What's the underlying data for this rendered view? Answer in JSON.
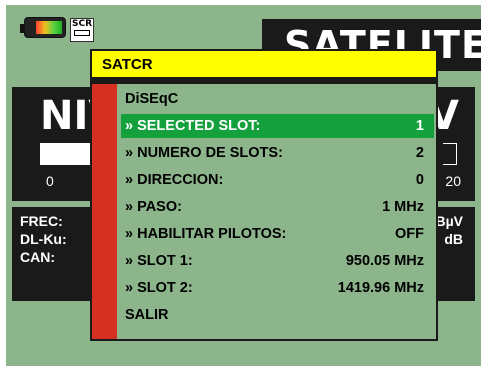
{
  "top_bar": {
    "battery_icon": "battery-icon",
    "scr_label": "SCR",
    "mode_title": "SATELITE"
  },
  "level_panel": {
    "title": "NIV",
    "unit_fragment": "V",
    "scale_min": "0",
    "scale_max": "20"
  },
  "measurements": {
    "labels": [
      "FREC:",
      "DL-Ku:",
      "CAN:"
    ],
    "units": [
      "dBµV",
      "dB"
    ]
  },
  "menu": {
    "title": "SATCR",
    "items": [
      {
        "label": "DiSEqC",
        "value": ""
      },
      {
        "label": "» SELECTED SLOT:",
        "value": "1"
      },
      {
        "label": "» NUMERO DE SLOTS:",
        "value": "2"
      },
      {
        "label": "» DIRECCION:",
        "value": "0"
      },
      {
        "label": "» PASO:",
        "value": "1 MHz"
      },
      {
        "label": "» HABILITAR PILOTOS:",
        "value": "OFF"
      },
      {
        "label": "» SLOT 1:",
        "value": "950.05 MHz"
      },
      {
        "label": "» SLOT 2:",
        "value": "1419.96 MHz"
      },
      {
        "label": "SALIR",
        "value": ""
      }
    ],
    "selected_index": 1
  },
  "colors": {
    "screen_bg": "#8cb58c",
    "menu_title_bg": "#ffff00",
    "selected_row_bg": "#14a03c",
    "menu_side_bar": "#d63023"
  }
}
